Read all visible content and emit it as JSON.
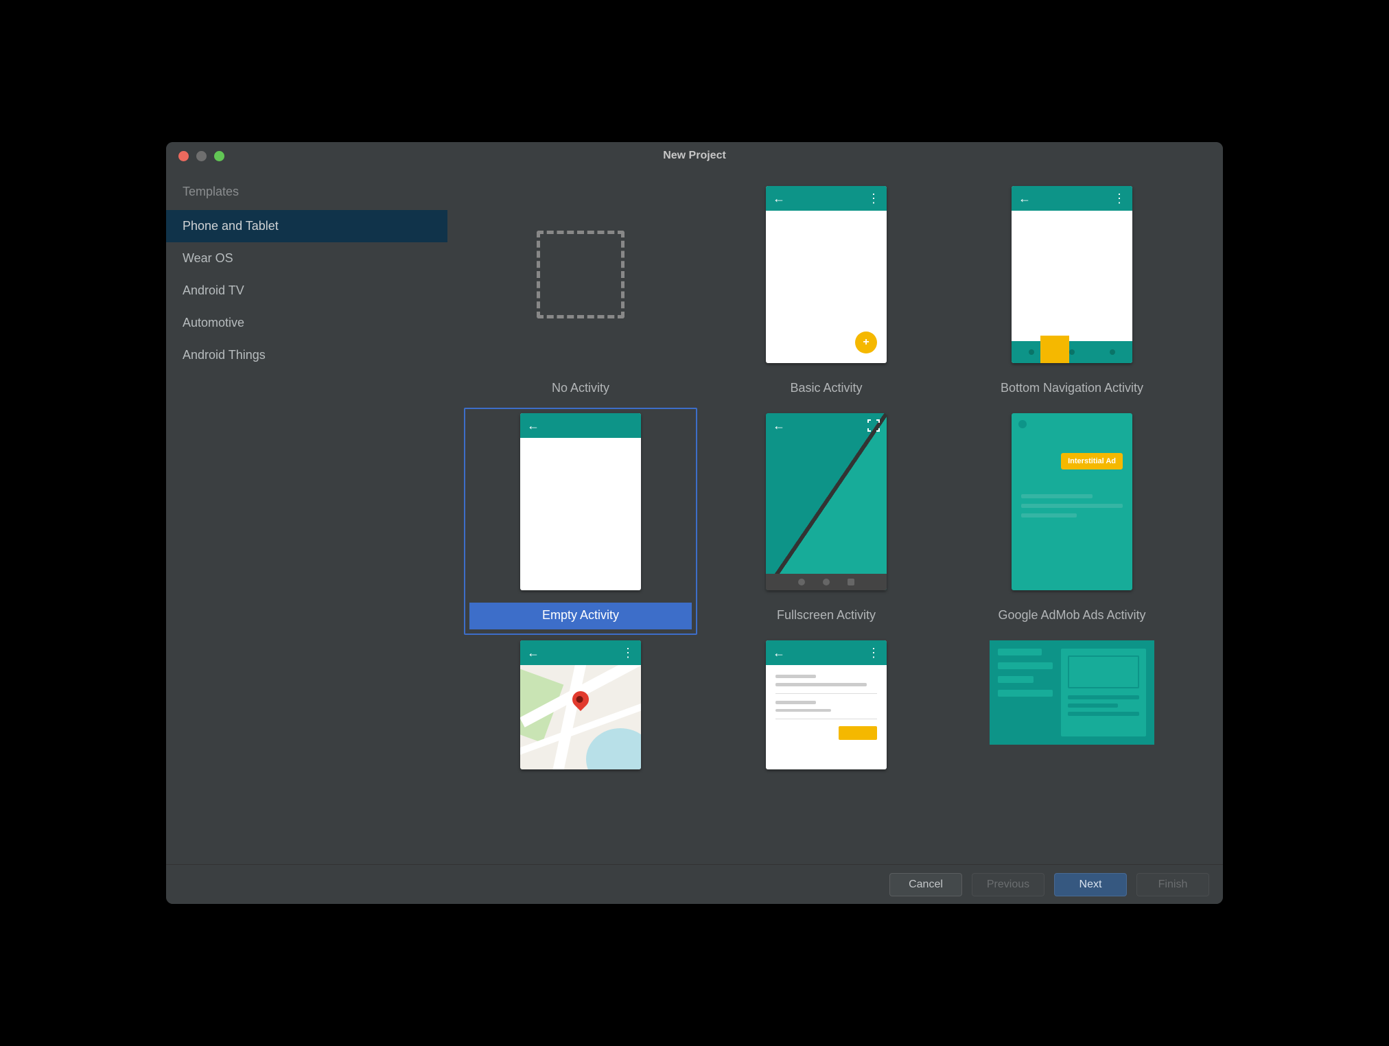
{
  "window_title": "New Project",
  "sidebar": {
    "header": "Templates",
    "items": [
      {
        "label": "Phone and Tablet",
        "selected": true
      },
      {
        "label": "Wear OS",
        "selected": false
      },
      {
        "label": "Android TV",
        "selected": false
      },
      {
        "label": "Automotive",
        "selected": false
      },
      {
        "label": "Android Things",
        "selected": false
      }
    ]
  },
  "templates": [
    {
      "label": "No Activity",
      "selected": false
    },
    {
      "label": "Basic Activity",
      "selected": false
    },
    {
      "label": "Bottom Navigation Activity",
      "selected": false
    },
    {
      "label": "Empty Activity",
      "selected": true
    },
    {
      "label": "Fullscreen Activity",
      "selected": false
    },
    {
      "label": "Google AdMob Ads Activity",
      "selected": false,
      "badge": "Interstitial Ad"
    },
    {
      "label": "",
      "selected": false
    },
    {
      "label": "",
      "selected": false
    },
    {
      "label": "",
      "selected": false
    }
  ],
  "footer": {
    "cancel": "Cancel",
    "previous": "Previous",
    "next": "Next",
    "finish": "Finish"
  }
}
